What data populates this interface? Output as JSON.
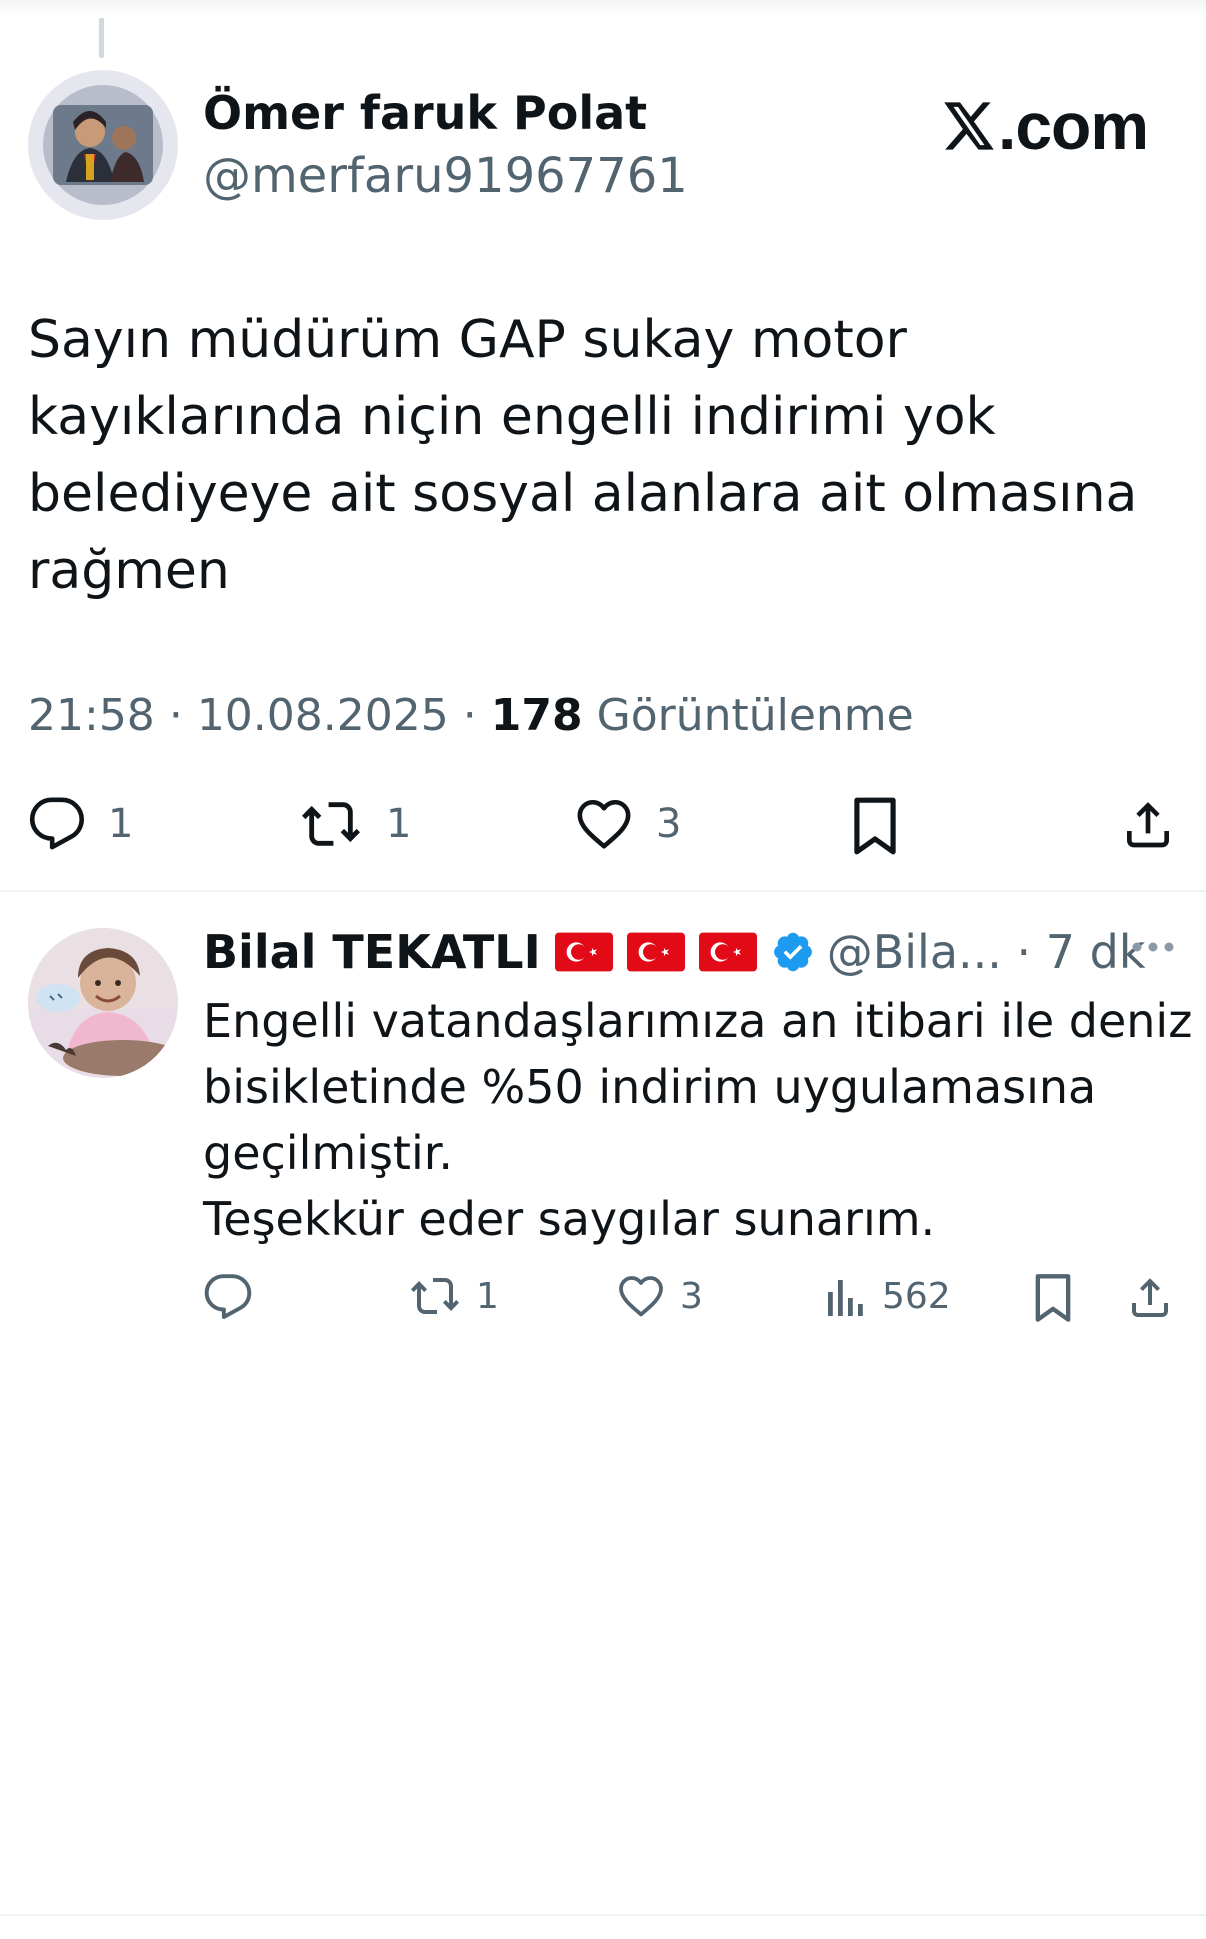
{
  "main_tweet": {
    "author_name": "Ömer faruk Polat",
    "author_handle": "@merfaru91967761",
    "brand": ".com",
    "text_lines": [
      "Sayın müdürüm GAP sukay motor",
      "kayıklarında niçin engelli indirimi yok",
      "belediyeye ait sosyal alanlara ait olmasına",
      "rağmen"
    ],
    "time": "21:58",
    "date": "10.08.2025",
    "separator": "·",
    "views": "178",
    "views_label": "Görüntülenme",
    "replies": "1",
    "retweets": "1",
    "likes": "3"
  },
  "reply_tweet": {
    "author_name": "Bilal TEKATLI",
    "author_handle": "@Bila... · 7 dk",
    "text_lines": [
      "Engelli vatandaşlarımıza an itibari ile deniz",
      "bisikletinde %50 indirim uygulamasına",
      "geçilmiştir.",
      "Teşekkür eder saygılar sunarım."
    ],
    "retweets": "1",
    "likes": "3",
    "views": "562"
  },
  "colors": {
    "text": "#0f1419",
    "secondary": "#536471",
    "verified": "#1d9bf0",
    "flag_red": "#e30a17",
    "divider": "#eff3f4"
  },
  "icons": [
    "reply-icon",
    "retweet-icon",
    "like-icon",
    "bookmark-icon",
    "share-icon",
    "views-icon",
    "verified-icon",
    "more-icon",
    "x-logo-icon",
    "turkish-flag-icon"
  ]
}
